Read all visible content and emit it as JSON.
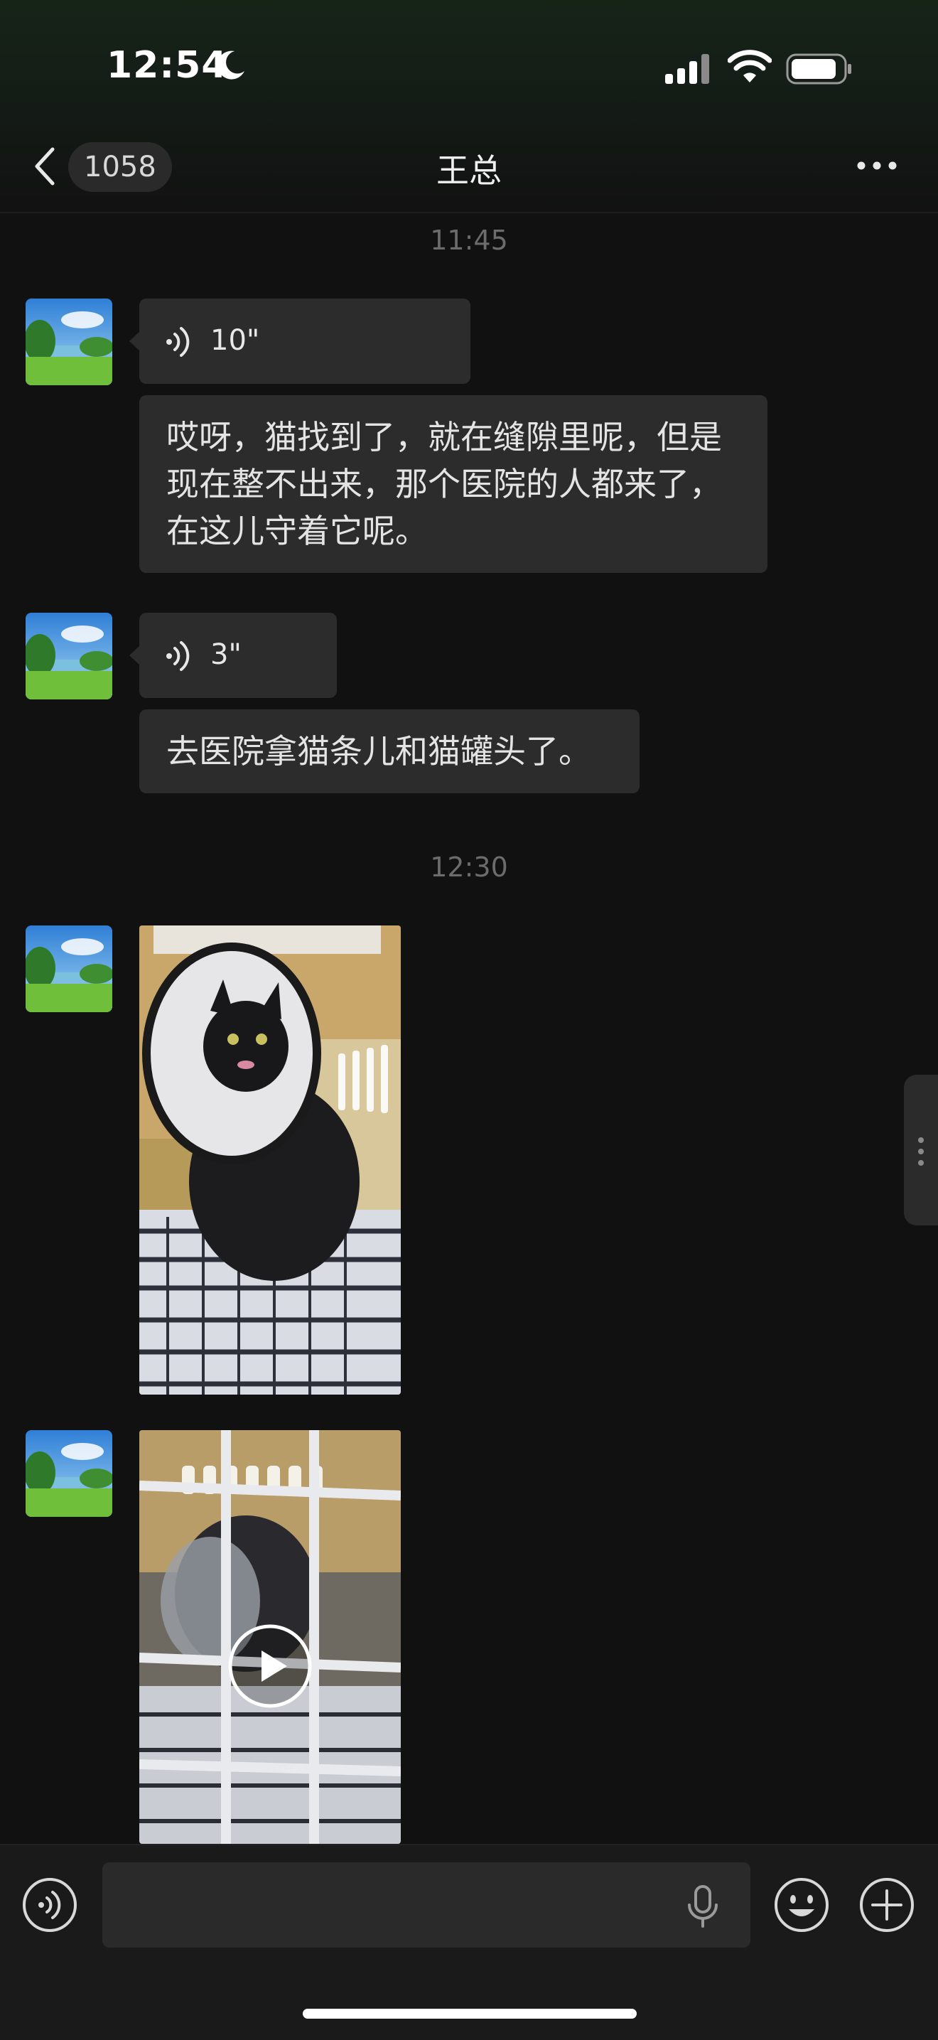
{
  "status_bar": {
    "time": "12:54",
    "icons": [
      "moon-icon",
      "cellular-signal-icon",
      "wifi-icon",
      "battery-icon"
    ]
  },
  "header": {
    "back_icon": "chevron-left-icon",
    "unread_count": "1058",
    "title": "王总",
    "more_icon": "more-dots-icon"
  },
  "messages": {
    "time_1": "11:45",
    "voice_1": {
      "duration": "10\""
    },
    "text_1": "哎呀，猫找到了，就在缝隙里呢，但是现在整不出来，那个医院的人都来了，在这儿守着它呢。",
    "voice_2": {
      "duration": "3\""
    },
    "text_2": "去医院拿猫条儿和猫罐头了。",
    "time_2": "12:30",
    "image_1": {
      "kind": "photo"
    },
    "video_1": {
      "kind": "video"
    }
  },
  "input_bar": {
    "voice_toggle_icon": "voice-toggle-icon",
    "mic_icon": "microphone-icon",
    "emoji_icon": "emoji-icon",
    "add_icon": "plus-circle-icon"
  },
  "colors": {
    "background": "#111111",
    "bubble": "#2c2c2c",
    "timestamp": "#6c6c6c"
  }
}
